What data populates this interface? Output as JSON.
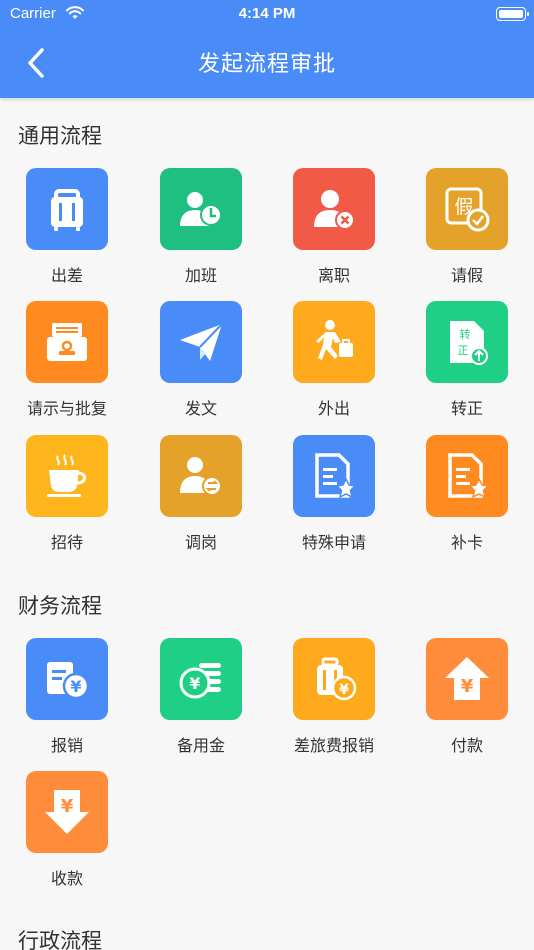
{
  "status_bar": {
    "carrier": "Carrier",
    "time": "4:14 PM"
  },
  "nav": {
    "title": "发起流程审批"
  },
  "sections": [
    {
      "title": "通用流程",
      "items": [
        {
          "label": "出差",
          "icon": "luggage-icon",
          "color": "#4a8cf7"
        },
        {
          "label": "加班",
          "icon": "user-clock-icon",
          "color": "#1fbf82"
        },
        {
          "label": "离职",
          "icon": "user-remove-icon",
          "color": "#f05a46"
        },
        {
          "label": "请假",
          "icon": "leave-stamp-icon",
          "color": "#e5a22a"
        },
        {
          "label": "请示与批复",
          "icon": "approval-stamp-icon",
          "color": "#ff8a1f"
        },
        {
          "label": "发文",
          "icon": "paper-plane-icon",
          "color": "#4a8cf7"
        },
        {
          "label": "外出",
          "icon": "walking-person-icon",
          "color": "#ffaa1c"
        },
        {
          "label": "转正",
          "icon": "regularize-doc-icon",
          "color": "#1fcf85"
        },
        {
          "label": "招待",
          "icon": "coffee-cup-icon",
          "color": "#ffb51c"
        },
        {
          "label": "调岗",
          "icon": "user-transfer-icon",
          "color": "#e5a22a"
        },
        {
          "label": "特殊申请",
          "icon": "document-star-icon",
          "color": "#4a8cf7"
        },
        {
          "label": "补卡",
          "icon": "document-star-icon",
          "color": "#ff8a1f"
        }
      ]
    },
    {
      "title": "财务流程",
      "items": [
        {
          "label": "报销",
          "icon": "receipt-yen-icon",
          "color": "#4a8cf7"
        },
        {
          "label": "备用金",
          "icon": "coins-yen-icon",
          "color": "#1fcf85"
        },
        {
          "label": "差旅费报销",
          "icon": "luggage-yen-icon",
          "color": "#ffaa1c"
        },
        {
          "label": "付款",
          "icon": "house-yen-icon",
          "color": "#ff8c3a"
        },
        {
          "label": "收款",
          "icon": "download-yen-icon",
          "color": "#ff8c3a"
        }
      ]
    },
    {
      "title": "行政流程",
      "items": []
    }
  ]
}
